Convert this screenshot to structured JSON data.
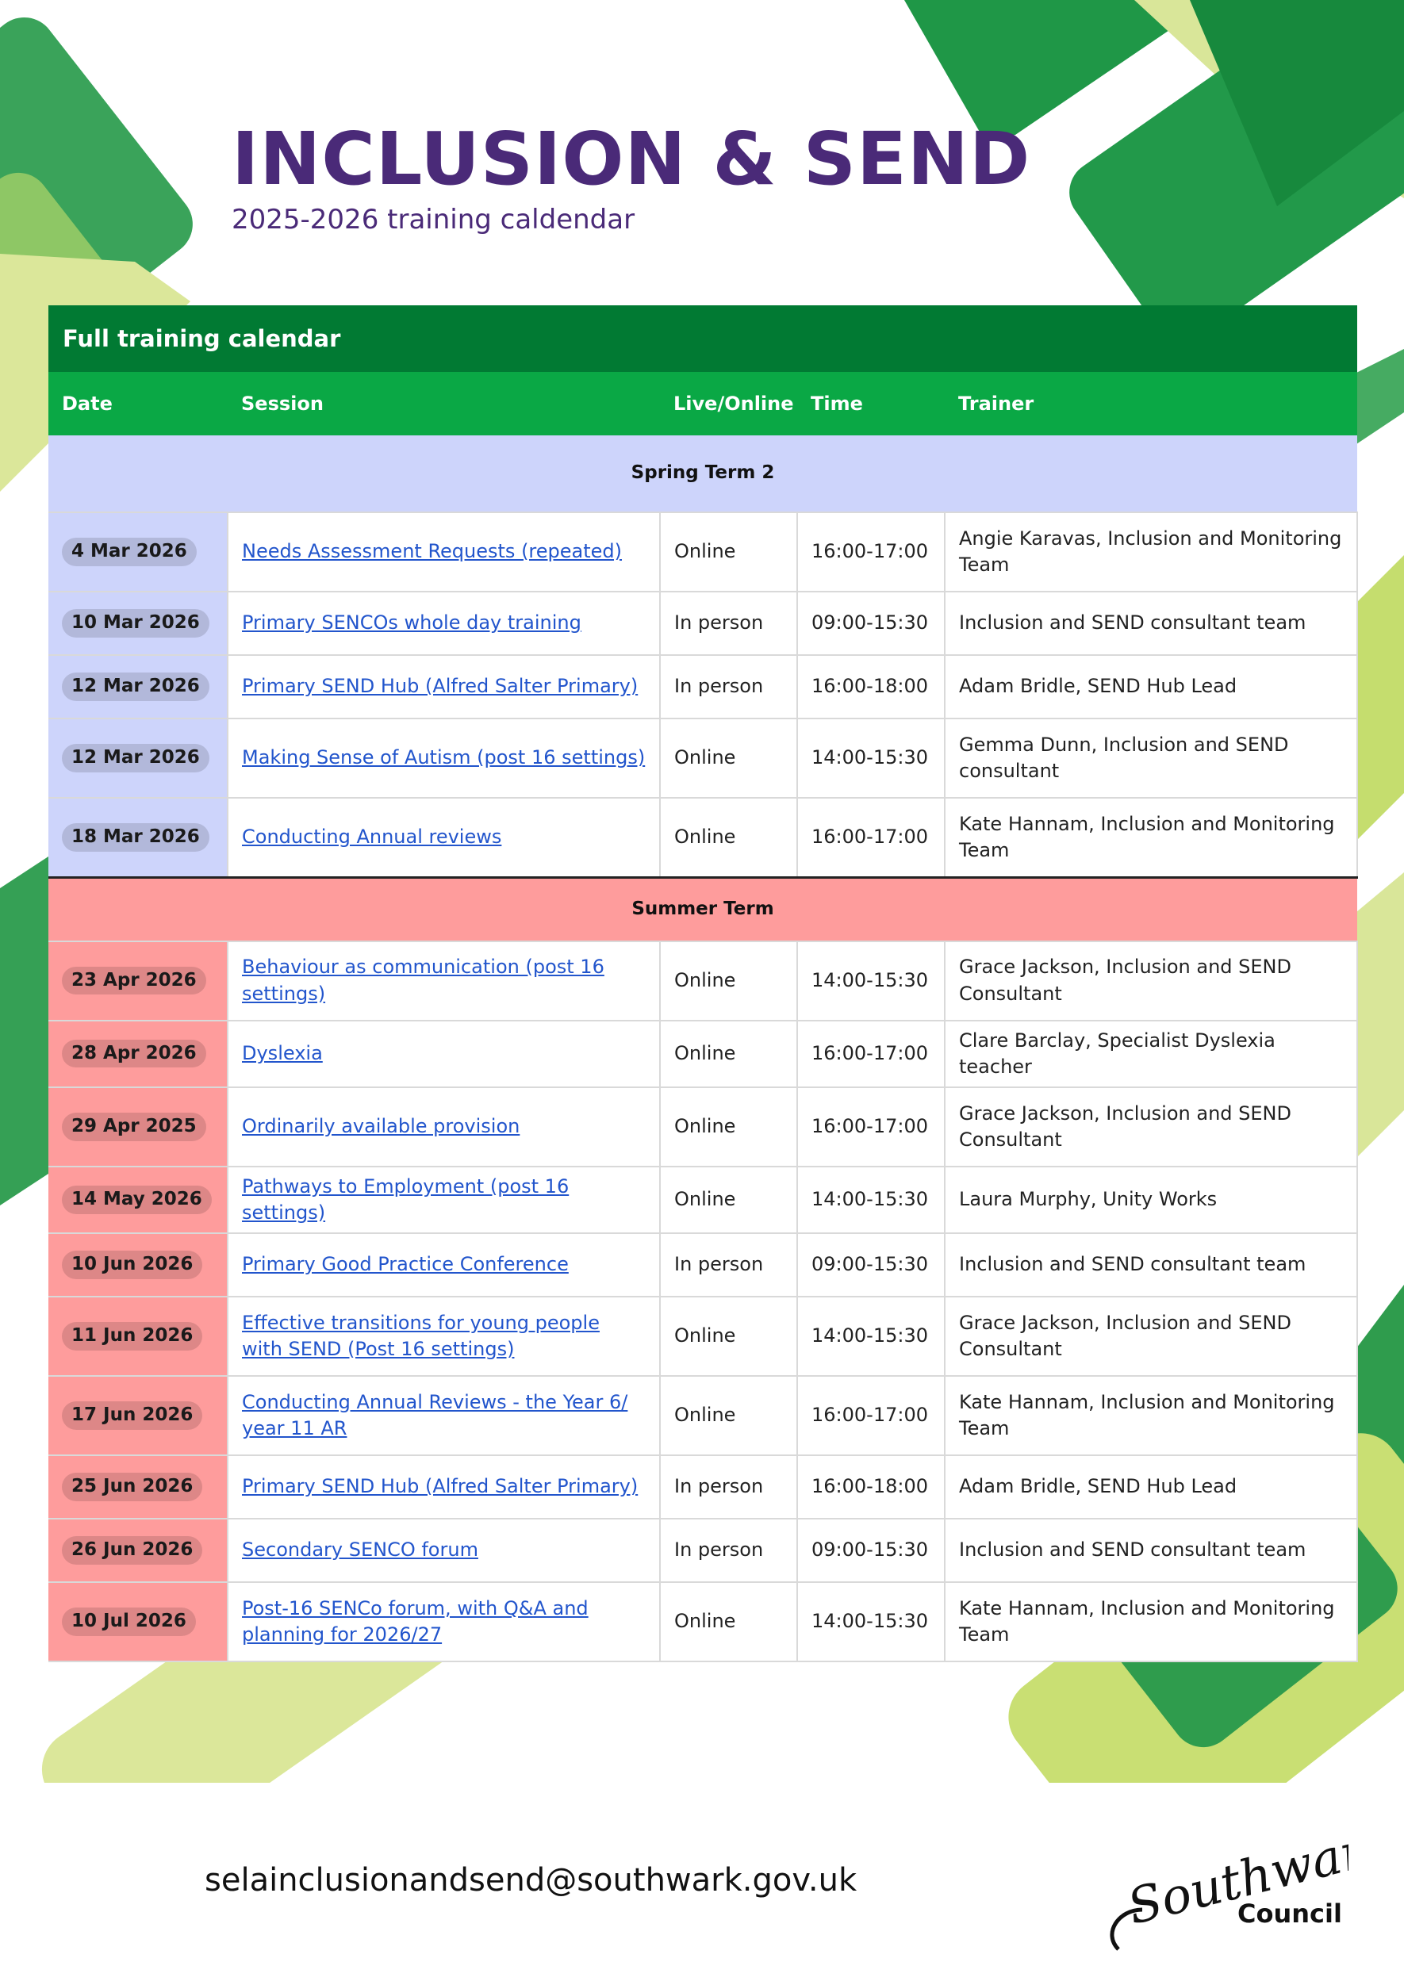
{
  "header": {
    "title": "INCLUSION & SEND",
    "subtitle": "2025-2026 training caldendar"
  },
  "calendar": {
    "title": "Full training calendar",
    "columns": [
      "Date",
      "Session",
      "Live/Online",
      "Time",
      "Trainer"
    ],
    "spring_label": "Spring Term 2",
    "summer_label": "Summer Term",
    "spring_rows": [
      {
        "date": "4 Mar 2026",
        "session": "Needs Assessment Requests (repeated)",
        "mode": "Online",
        "time": "16:00-17:00",
        "trainer": "Angie Karavas, Inclusion and Monitoring Team"
      },
      {
        "date": "10 Mar 2026",
        "session": "Primary SENCOs whole day training",
        "mode": "In person",
        "time": "09:00-15:30",
        "trainer": "Inclusion and SEND consultant team"
      },
      {
        "date": "12 Mar 2026",
        "session": "Primary SEND Hub (Alfred Salter Primary)",
        "mode": "In person",
        "time": "16:00-18:00",
        "trainer": "Adam Bridle, SEND Hub Lead"
      },
      {
        "date": "12 Mar 2026",
        "session": "Making Sense of Autism (post 16 settings)",
        "mode": "Online",
        "time": "14:00-15:30",
        "trainer": "Gemma Dunn, Inclusion and SEND consultant"
      },
      {
        "date": "18 Mar 2026",
        "session": "Conducting Annual reviews",
        "mode": "Online",
        "time": "16:00-17:00",
        "trainer": "Kate Hannam, Inclusion and Monitoring Team"
      }
    ],
    "summer_rows": [
      {
        "date": "23 Apr 2026",
        "session": "Behaviour as communication (post 16 settings)",
        "mode": "Online",
        "time": "14:00-15:30",
        "trainer": "Grace Jackson, Inclusion and SEND Consultant"
      },
      {
        "date": "28 Apr 2026",
        "session": "Dyslexia",
        "mode": "Online",
        "time": "16:00-17:00",
        "trainer": "Clare Barclay, Specialist Dyslexia teacher"
      },
      {
        "date": "29 Apr 2025",
        "session": "Ordinarily available provision",
        "mode": "Online",
        "time": "16:00-17:00",
        "trainer": "Grace Jackson, Inclusion and SEND Consultant"
      },
      {
        "date": "14 May 2026",
        "session": "Pathways to Employment (post 16 settings)",
        "mode": "Online",
        "time": "14:00-15:30",
        "trainer": "Laura Murphy, Unity Works"
      },
      {
        "date": "10 Jun 2026",
        "session": "Primary Good Practice Conference",
        "mode": "In person",
        "time": "09:00-15:30",
        "trainer": "Inclusion and SEND consultant team"
      },
      {
        "date": "11 Jun 2026",
        "session": "Effective transitions for young people with SEND (Post 16 settings)",
        "mode": "Online",
        "time": "14:00-15:30",
        "trainer": "Grace Jackson, Inclusion and SEND Consultant"
      },
      {
        "date": "17 Jun 2026",
        "session": "Conducting Annual Reviews - the Year 6/ year 11 AR",
        "mode": "Online",
        "time": "16:00-17:00",
        "trainer": "Kate Hannam, Inclusion and Monitoring Team"
      },
      {
        "date": "25 Jun 2026",
        "session": "Primary SEND Hub (Alfred Salter Primary)",
        "mode": "In person",
        "time": "16:00-18:00",
        "trainer": "Adam Bridle, SEND Hub Lead"
      },
      {
        "date": "26 Jun 2026",
        "session": "Secondary SENCO forum",
        "mode": "In person",
        "time": "09:00-15:30",
        "trainer": "Inclusion and SEND consultant team"
      },
      {
        "date": "10 Jul 2026",
        "session": "Post-16 SENCo forum, with Q&A and planning for 2026/27",
        "mode": "Online",
        "time": "14:00-15:30",
        "trainer": "Kate Hannam, Inclusion and Monitoring Team"
      }
    ]
  },
  "footer": {
    "email": "selainclusionandsend@southwark.gov.uk",
    "logo_script": "Southwark",
    "logo_council": "Council"
  },
  "colors": {
    "title": "#4a2a78",
    "banner_dark": "#017a33",
    "banner_header": "#0aa845",
    "spring": "#cdd4fb",
    "summer": "#fe9c9c",
    "link": "#2255cc"
  }
}
